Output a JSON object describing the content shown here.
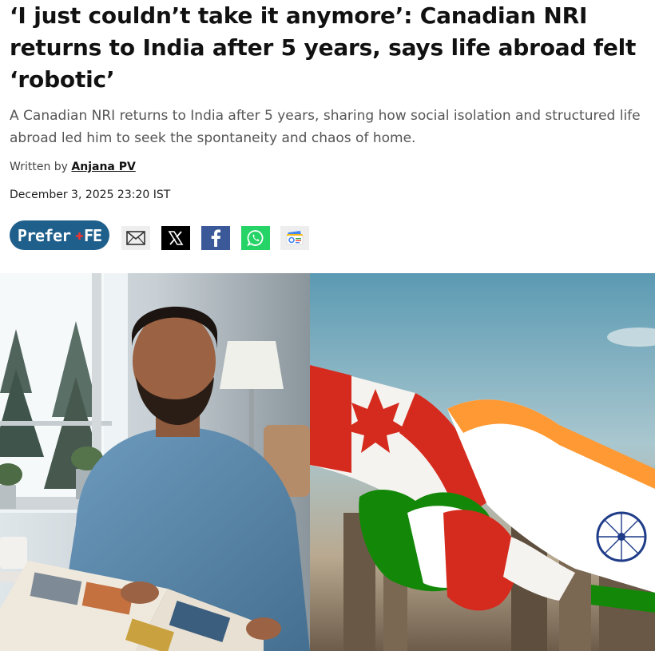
{
  "article": {
    "headline": "‘I just couldn’t take it anymore’: Canadian NRI returns to India after 5 years, says life abroad felt ‘robotic’",
    "summary": "A Canadian NRI returns to India after 5 years, sharing how social isolation and structured life abroad led him to seek the spontaneity and chaos of home.",
    "byline_prefix": "Written by",
    "author": "Anjana PV",
    "date": "December 3, 2025 23:20 IST"
  },
  "prefer_button": {
    "text_left": "Prefer",
    "text_right": "FE",
    "color": "#1e5f8c"
  },
  "share": {
    "icons": [
      "mail-icon",
      "x-icon",
      "facebook-icon",
      "whatsapp-icon",
      "google-news-icon"
    ]
  },
  "colors": {
    "whatsapp": "#25d366",
    "facebook": "#3b5998",
    "canada_red": "#d52b1e",
    "india_saffron": "#ff9933",
    "india_green": "#138808"
  }
}
